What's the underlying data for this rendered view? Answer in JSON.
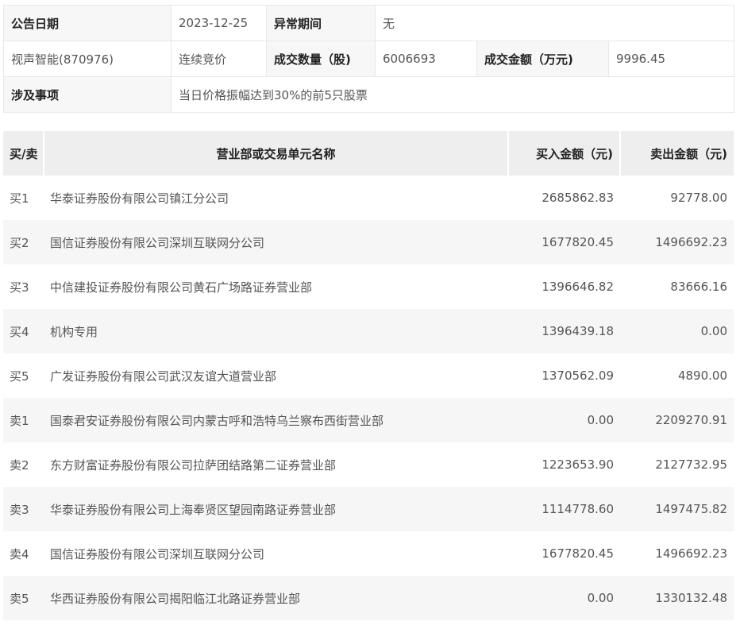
{
  "info": {
    "announce_date_label": "公告日期",
    "announce_date_value": "2023-12-25",
    "abnormal_period_label": "异常期间",
    "abnormal_period_value": "无",
    "stock_name": "视声智能(870976)",
    "trade_method": "连续竞价",
    "volume_label": "成交数量（股)",
    "volume_value": "6006693",
    "amount_label": "成交金额（万元)",
    "amount_value": "9996.45",
    "matter_label": "涉及事项",
    "matter_value": "当日价格振幅达到30%的前5只股票"
  },
  "table": {
    "headers": {
      "side": "买/卖",
      "name": "营业部或交易单元名称",
      "buy": "买入金额（元)",
      "sell": "卖出金额（元)"
    },
    "rows": [
      {
        "side": "买1",
        "name": "华泰证券股份有限公司镇江分公司",
        "buy": "2685862.83",
        "sell": "92778.00"
      },
      {
        "side": "买2",
        "name": "国信证券股份有限公司深圳互联网分公司",
        "buy": "1677820.45",
        "sell": "1496692.23"
      },
      {
        "side": "买3",
        "name": "中信建投证券股份有限公司黄石广场路证券营业部",
        "buy": "1396646.82",
        "sell": "83666.16"
      },
      {
        "side": "买4",
        "name": "机构专用",
        "buy": "1396439.18",
        "sell": "0.00"
      },
      {
        "side": "买5",
        "name": "广发证券股份有限公司武汉友谊大道营业部",
        "buy": "1370562.09",
        "sell": "4890.00"
      },
      {
        "side": "卖1",
        "name": "国泰君安证券股份有限公司内蒙古呼和浩特乌兰察布西街营业部",
        "buy": "0.00",
        "sell": "2209270.91"
      },
      {
        "side": "卖2",
        "name": "东方财富证券股份有限公司拉萨团结路第二证券营业部",
        "buy": "1223653.90",
        "sell": "2127732.95"
      },
      {
        "side": "卖3",
        "name": "华泰证券股份有限公司上海奉贤区望园南路证券营业部",
        "buy": "1114778.60",
        "sell": "1497475.82"
      },
      {
        "side": "卖4",
        "name": "国信证券股份有限公司深圳互联网分公司",
        "buy": "1677820.45",
        "sell": "1496692.23"
      },
      {
        "side": "卖5",
        "name": "华西证券股份有限公司揭阳临江北路证券营业部",
        "buy": "0.00",
        "sell": "1330132.48"
      }
    ]
  }
}
